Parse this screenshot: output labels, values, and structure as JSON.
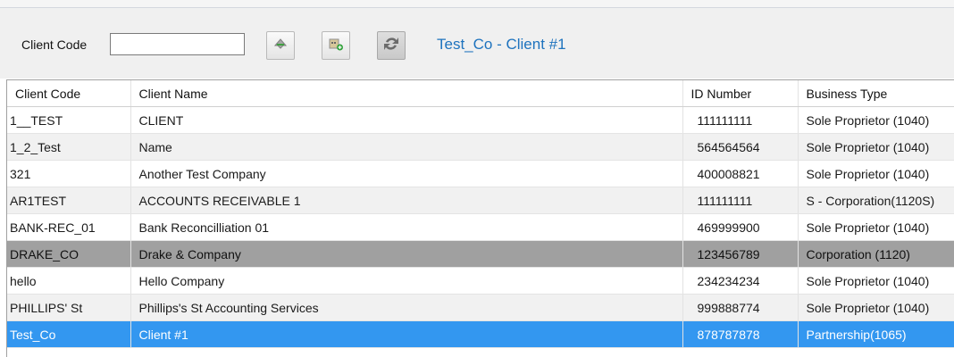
{
  "toolbar": {
    "client_code_label": "Client Code",
    "client_code_value": "",
    "selected_client_title": "Test_Co - Client #1"
  },
  "icons": {
    "find_button": "search-arrow-icon",
    "add_button": "add-client-icon",
    "refresh_button": "refresh-icon"
  },
  "colors": {
    "title_blue": "#1e73be",
    "selected_row": "#3397f0",
    "highlight_row": "#a0a0a0"
  },
  "grid": {
    "columns": [
      "Client Code",
      "Client Name",
      "ID Number",
      "Business Type"
    ],
    "rows": [
      {
        "code": "1__TEST",
        "name": "CLIENT",
        "id": "111111111",
        "type": "Sole Proprietor (1040)"
      },
      {
        "code": "1_2_Test",
        "name": "Name",
        "id": "564564564",
        "type": "Sole Proprietor (1040)"
      },
      {
        "code": "321",
        "name": "Another Test Company",
        "id": "400008821",
        "type": "Sole Proprietor (1040)"
      },
      {
        "code": "AR1TEST",
        "name": "ACCOUNTS RECEIVABLE 1",
        "id": "111111111",
        "type": "S - Corporation(1120S)"
      },
      {
        "code": "BANK-REC_01",
        "name": "Bank Reconcilliation 01",
        "id": "469999900",
        "type": "Sole Proprietor (1040)"
      },
      {
        "code": "DRAKE_CO",
        "name": "Drake & Company",
        "id": "123456789",
        "type": "Corporation (1120)"
      },
      {
        "code": "hello",
        "name": "Hello Company",
        "id": "234234234",
        "type": "Sole Proprietor (1040)"
      },
      {
        "code": "PHILLIPS' St",
        "name": "Phillips's St Accounting Services",
        "id": "999888774",
        "type": "Sole Proprietor (1040)"
      },
      {
        "code": "Test_Co",
        "name": "Client #1",
        "id": "878787878",
        "type": "Partnership(1065)"
      }
    ]
  }
}
